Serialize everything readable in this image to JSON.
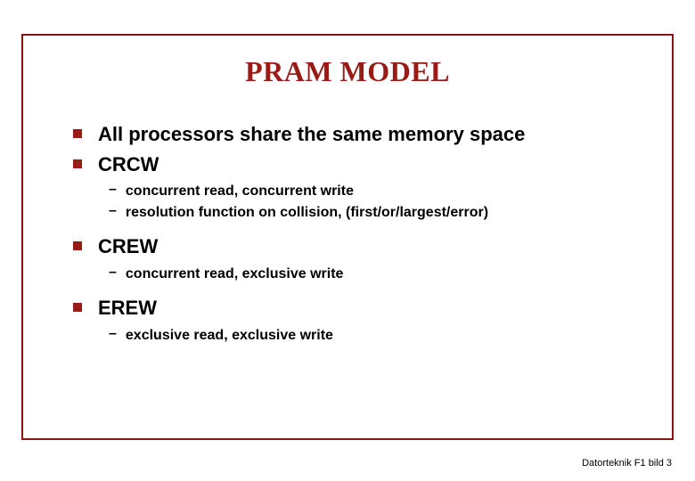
{
  "title": "PRAM MODEL",
  "bullets": [
    {
      "text": "All processors share the same memory space",
      "sub": []
    },
    {
      "text": "CRCW",
      "sub": [
        "concurrent read, concurrent write",
        "resolution function on collision, (first/or/largest/error)"
      ]
    },
    {
      "text": "CREW",
      "sub": [
        "concurrent read, exclusive write"
      ]
    },
    {
      "text": "EREW",
      "sub": [
        "exclusive read, exclusive write"
      ]
    }
  ],
  "footer": "Datorteknik F1 bild 3"
}
